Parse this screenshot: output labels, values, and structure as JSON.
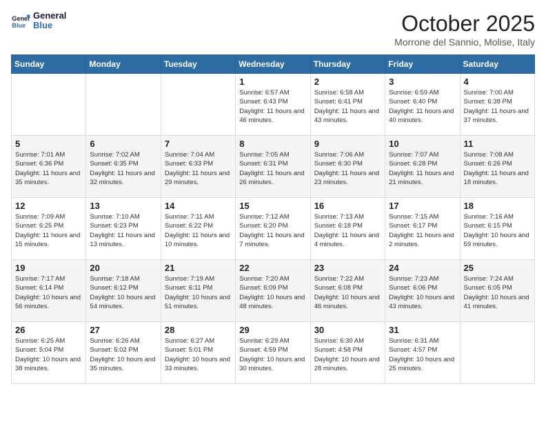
{
  "header": {
    "logo_line1": "General",
    "logo_line2": "Blue",
    "month": "October 2025",
    "location": "Morrone del Sannio, Molise, Italy"
  },
  "weekdays": [
    "Sunday",
    "Monday",
    "Tuesday",
    "Wednesday",
    "Thursday",
    "Friday",
    "Saturday"
  ],
  "weeks": [
    [
      {
        "day": null
      },
      {
        "day": null
      },
      {
        "day": null
      },
      {
        "day": "1",
        "sunrise": "6:57 AM",
        "sunset": "6:43 PM",
        "daylight": "11 hours and 46 minutes."
      },
      {
        "day": "2",
        "sunrise": "6:58 AM",
        "sunset": "6:41 PM",
        "daylight": "11 hours and 43 minutes."
      },
      {
        "day": "3",
        "sunrise": "6:59 AM",
        "sunset": "6:40 PM",
        "daylight": "11 hours and 40 minutes."
      },
      {
        "day": "4",
        "sunrise": "7:00 AM",
        "sunset": "6:38 PM",
        "daylight": "11 hours and 37 minutes."
      }
    ],
    [
      {
        "day": "5",
        "sunrise": "7:01 AM",
        "sunset": "6:36 PM",
        "daylight": "11 hours and 35 minutes."
      },
      {
        "day": "6",
        "sunrise": "7:02 AM",
        "sunset": "6:35 PM",
        "daylight": "11 hours and 32 minutes."
      },
      {
        "day": "7",
        "sunrise": "7:04 AM",
        "sunset": "6:33 PM",
        "daylight": "11 hours and 29 minutes."
      },
      {
        "day": "8",
        "sunrise": "7:05 AM",
        "sunset": "6:31 PM",
        "daylight": "11 hours and 26 minutes."
      },
      {
        "day": "9",
        "sunrise": "7:06 AM",
        "sunset": "6:30 PM",
        "daylight": "11 hours and 23 minutes."
      },
      {
        "day": "10",
        "sunrise": "7:07 AM",
        "sunset": "6:28 PM",
        "daylight": "11 hours and 21 minutes."
      },
      {
        "day": "11",
        "sunrise": "7:08 AM",
        "sunset": "6:26 PM",
        "daylight": "11 hours and 18 minutes."
      }
    ],
    [
      {
        "day": "12",
        "sunrise": "7:09 AM",
        "sunset": "6:25 PM",
        "daylight": "11 hours and 15 minutes."
      },
      {
        "day": "13",
        "sunrise": "7:10 AM",
        "sunset": "6:23 PM",
        "daylight": "11 hours and 13 minutes."
      },
      {
        "day": "14",
        "sunrise": "7:11 AM",
        "sunset": "6:22 PM",
        "daylight": "11 hours and 10 minutes."
      },
      {
        "day": "15",
        "sunrise": "7:12 AM",
        "sunset": "6:20 PM",
        "daylight": "11 hours and 7 minutes."
      },
      {
        "day": "16",
        "sunrise": "7:13 AM",
        "sunset": "6:18 PM",
        "daylight": "11 hours and 4 minutes."
      },
      {
        "day": "17",
        "sunrise": "7:15 AM",
        "sunset": "6:17 PM",
        "daylight": "11 hours and 2 minutes."
      },
      {
        "day": "18",
        "sunrise": "7:16 AM",
        "sunset": "6:15 PM",
        "daylight": "10 hours and 59 minutes."
      }
    ],
    [
      {
        "day": "19",
        "sunrise": "7:17 AM",
        "sunset": "6:14 PM",
        "daylight": "10 hours and 56 minutes."
      },
      {
        "day": "20",
        "sunrise": "7:18 AM",
        "sunset": "6:12 PM",
        "daylight": "10 hours and 54 minutes."
      },
      {
        "day": "21",
        "sunrise": "7:19 AM",
        "sunset": "6:11 PM",
        "daylight": "10 hours and 51 minutes."
      },
      {
        "day": "22",
        "sunrise": "7:20 AM",
        "sunset": "6:09 PM",
        "daylight": "10 hours and 48 minutes."
      },
      {
        "day": "23",
        "sunrise": "7:22 AM",
        "sunset": "6:08 PM",
        "daylight": "10 hours and 46 minutes."
      },
      {
        "day": "24",
        "sunrise": "7:23 AM",
        "sunset": "6:06 PM",
        "daylight": "10 hours and 43 minutes."
      },
      {
        "day": "25",
        "sunrise": "7:24 AM",
        "sunset": "6:05 PM",
        "daylight": "10 hours and 41 minutes."
      }
    ],
    [
      {
        "day": "26",
        "sunrise": "6:25 AM",
        "sunset": "5:04 PM",
        "daylight": "10 hours and 38 minutes."
      },
      {
        "day": "27",
        "sunrise": "6:26 AM",
        "sunset": "5:02 PM",
        "daylight": "10 hours and 35 minutes."
      },
      {
        "day": "28",
        "sunrise": "6:27 AM",
        "sunset": "5:01 PM",
        "daylight": "10 hours and 33 minutes."
      },
      {
        "day": "29",
        "sunrise": "6:29 AM",
        "sunset": "4:59 PM",
        "daylight": "10 hours and 30 minutes."
      },
      {
        "day": "30",
        "sunrise": "6:30 AM",
        "sunset": "4:58 PM",
        "daylight": "10 hours and 28 minutes."
      },
      {
        "day": "31",
        "sunrise": "6:31 AM",
        "sunset": "4:57 PM",
        "daylight": "10 hours and 25 minutes."
      },
      {
        "day": null
      }
    ]
  ],
  "labels": {
    "sunrise": "Sunrise:",
    "sunset": "Sunset:",
    "daylight": "Daylight:"
  }
}
